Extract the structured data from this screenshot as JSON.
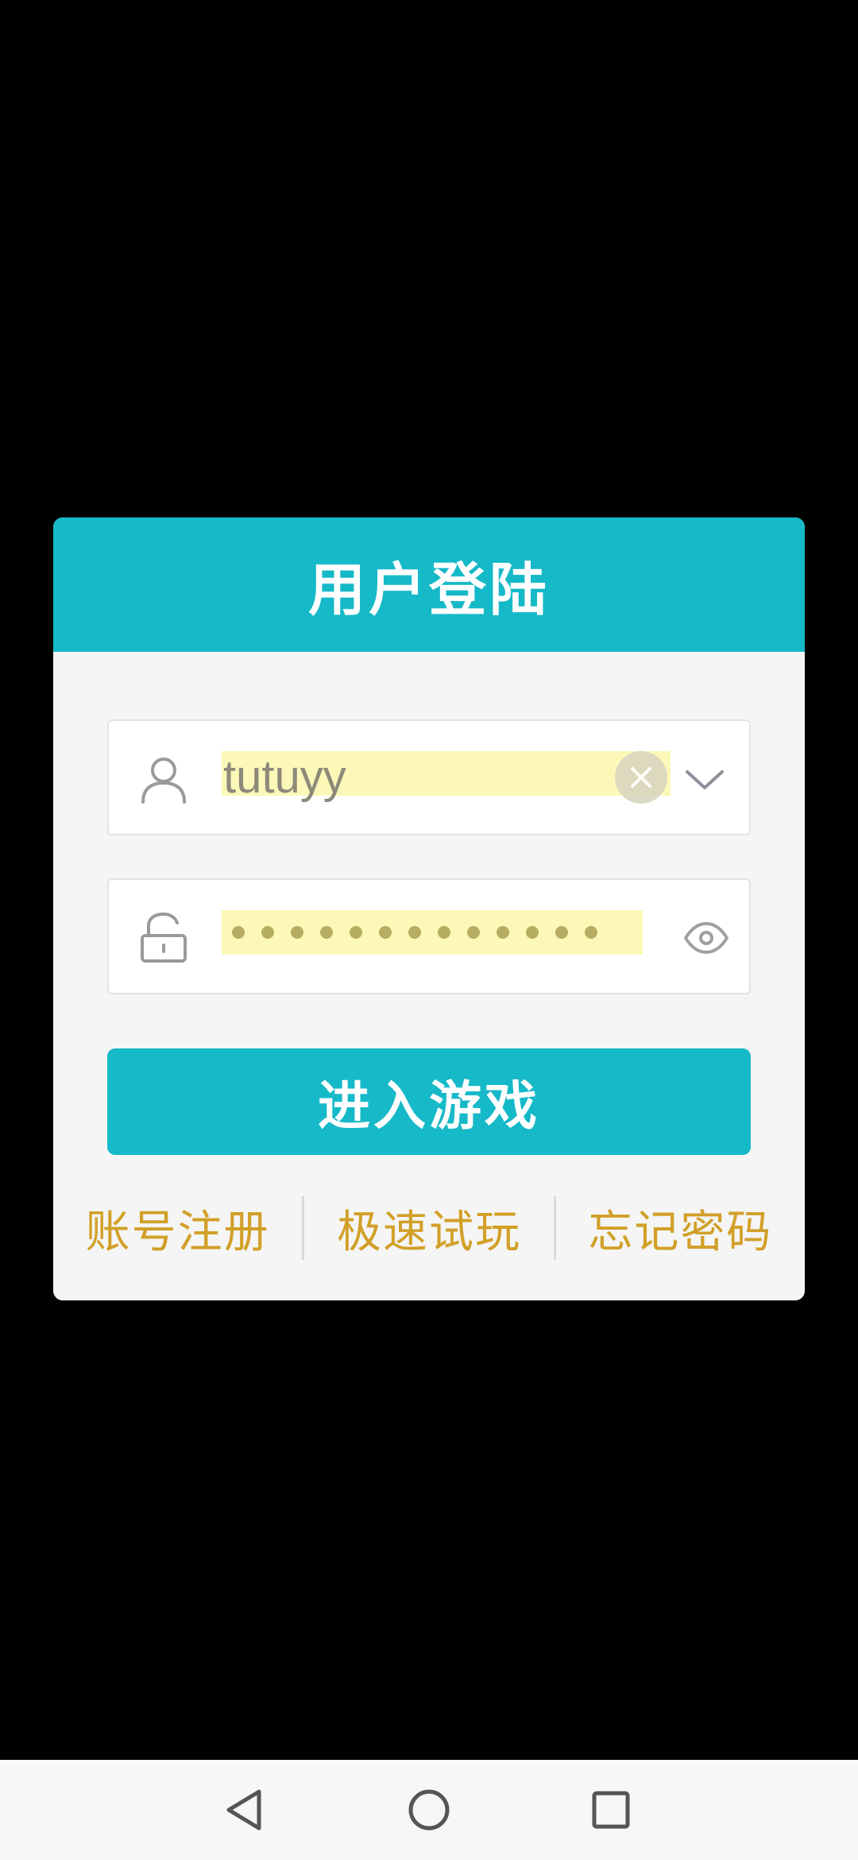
{
  "dialog": {
    "title": "用户登陆",
    "username": {
      "value": "tutuyy",
      "user_icon": "user-icon",
      "clear_icon": "clear-icon",
      "dropdown_icon": "chevron-down-icon"
    },
    "password": {
      "masked_length": 13,
      "lock_icon": "lock-icon",
      "visibility_icon": "eye-icon"
    },
    "enter_button": "进入游戏",
    "links": {
      "register": "账号注册",
      "quick_play": "极速试玩",
      "forgot_password": "忘记密码"
    }
  },
  "colors": {
    "accent": "#16b9c8",
    "link": "#d2a028",
    "autofill_highlight": "#fcf8b8",
    "dialog_background": "#f5f5f5"
  },
  "nav_bar": {
    "back_icon": "back-triangle-icon",
    "home_icon": "home-circle-icon",
    "recent_icon": "recent-square-icon"
  }
}
